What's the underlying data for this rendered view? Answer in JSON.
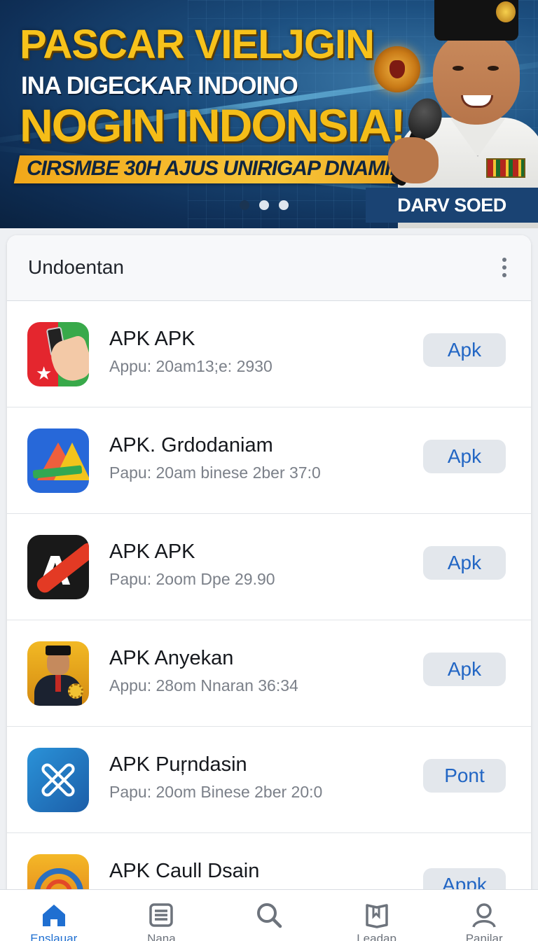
{
  "banner": {
    "headline_1": "PASCAR VIELJGIN",
    "headline_2": "INA DIGECKAR INDOINO",
    "headline_3": "NOGIN INDONSIA!",
    "ribbon_text": "CIRSMBE 30H  AJUS UNIRIGAP DNAMIK",
    "name_tag": "DARV SOED",
    "slides": [
      {
        "active": true
      },
      {
        "active": false
      },
      {
        "active": false
      }
    ]
  },
  "card": {
    "title": "Undoentan",
    "items": [
      {
        "name": "APK APK",
        "meta": "Appu: 20am13;e: 2930",
        "button": "Apk",
        "icon": "hand-phone-icon"
      },
      {
        "name": "APK. Grdodaniam",
        "meta": "Papu: 20am binese 2ber 37:0",
        "button": "Apk",
        "icon": "triangle-logo-icon"
      },
      {
        "name": "APK APK",
        "meta": "Papu: 2oom Dpe 29.90",
        "button": "Apk",
        "icon": "a-slash-icon"
      },
      {
        "name": "APK Anyekan",
        "meta": "Appu: 28om Nnaran 36:34",
        "button": "Apk",
        "icon": "official-portrait-icon"
      },
      {
        "name": "APK Puŗndasin",
        "meta": "Papu: 20om Binese 2ber 20:0",
        "button": "Pont",
        "icon": "x-knot-icon"
      },
      {
        "name": "APK Caull Dsain",
        "meta": "",
        "button": "Appk",
        "icon": "target-rings-icon"
      }
    ]
  },
  "bottom_nav": [
    {
      "label": "Enslauar",
      "icon": "home-icon",
      "active": true
    },
    {
      "label": "Nana",
      "icon": "list-icon",
      "active": false
    },
    {
      "label": "",
      "icon": "search-icon",
      "active": false
    },
    {
      "label": "Leadap",
      "icon": "book-icon",
      "active": false
    },
    {
      "label": "Panilar",
      "icon": "profile-icon",
      "active": false
    }
  ],
  "colors": {
    "accent_blue": "#1f6fd1",
    "button_bg": "#e3e7ec",
    "banner_gold": "#f7c21b",
    "banner_navy": "#1a4373"
  }
}
